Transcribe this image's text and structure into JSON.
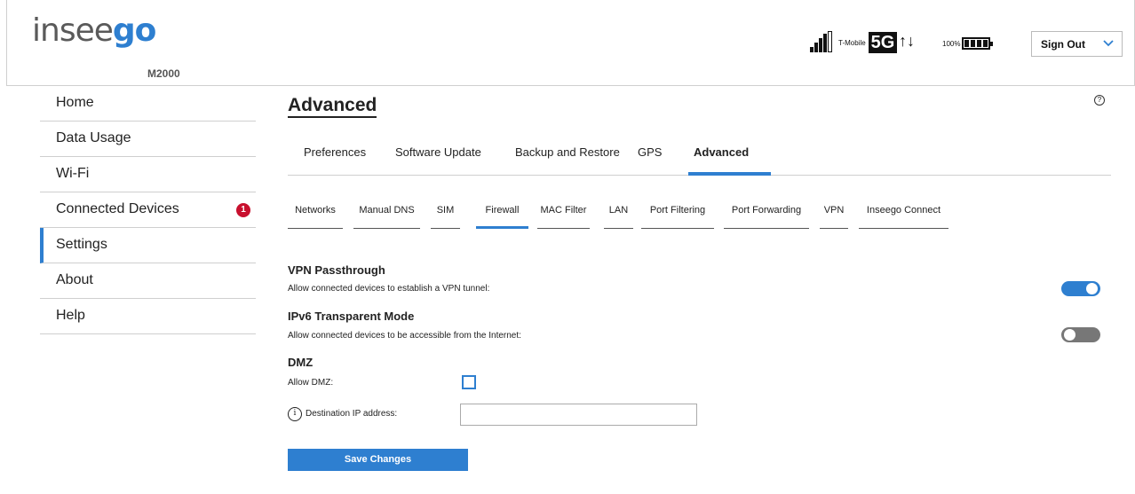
{
  "header": {
    "logo_text_a": "insee",
    "logo_text_b": "go",
    "model": "M2000",
    "carrier": "T-Mobile",
    "network": "5G",
    "arrows": "↑↓",
    "battery_pct": "100%",
    "signout_label": "Sign Out"
  },
  "sidebar": {
    "items": [
      {
        "label": "Home"
      },
      {
        "label": "Data Usage"
      },
      {
        "label": "Wi-Fi"
      },
      {
        "label": "Connected Devices",
        "badge": "1"
      },
      {
        "label": "Settings"
      },
      {
        "label": "About"
      },
      {
        "label": "Help"
      }
    ]
  },
  "main": {
    "title": "Advanced",
    "help": "?",
    "tabs": [
      {
        "label": "Preferences"
      },
      {
        "label": "Software Update"
      },
      {
        "label": "Backup and Restore"
      },
      {
        "label": "GPS"
      },
      {
        "label": "Advanced"
      }
    ],
    "subtabs": [
      {
        "label": "Networks"
      },
      {
        "label": "Manual DNS"
      },
      {
        "label": "SIM"
      },
      {
        "label": "Firewall"
      },
      {
        "label": "MAC Filter"
      },
      {
        "label": "LAN"
      },
      {
        "label": "Port Filtering"
      },
      {
        "label": "Port Forwarding"
      },
      {
        "label": "VPN"
      },
      {
        "label": "Inseego Connect"
      }
    ],
    "vpn": {
      "title": "VPN Passthrough",
      "desc": "Allow connected devices to establish a VPN tunnel:",
      "enabled": true
    },
    "ipv6": {
      "title": "IPv6 Transparent Mode",
      "desc": "Allow connected devices to be accessible from the Internet:",
      "enabled": false
    },
    "dmz": {
      "title": "DMZ",
      "allow_label": "Allow DMZ:",
      "allow_checked": false,
      "info": "i",
      "dest_label": "Destination IP address:",
      "dest_value": ""
    },
    "save_label": "Save Changes"
  },
  "colors": {
    "accent": "#2e7fd0",
    "badge": "#c8102e"
  }
}
